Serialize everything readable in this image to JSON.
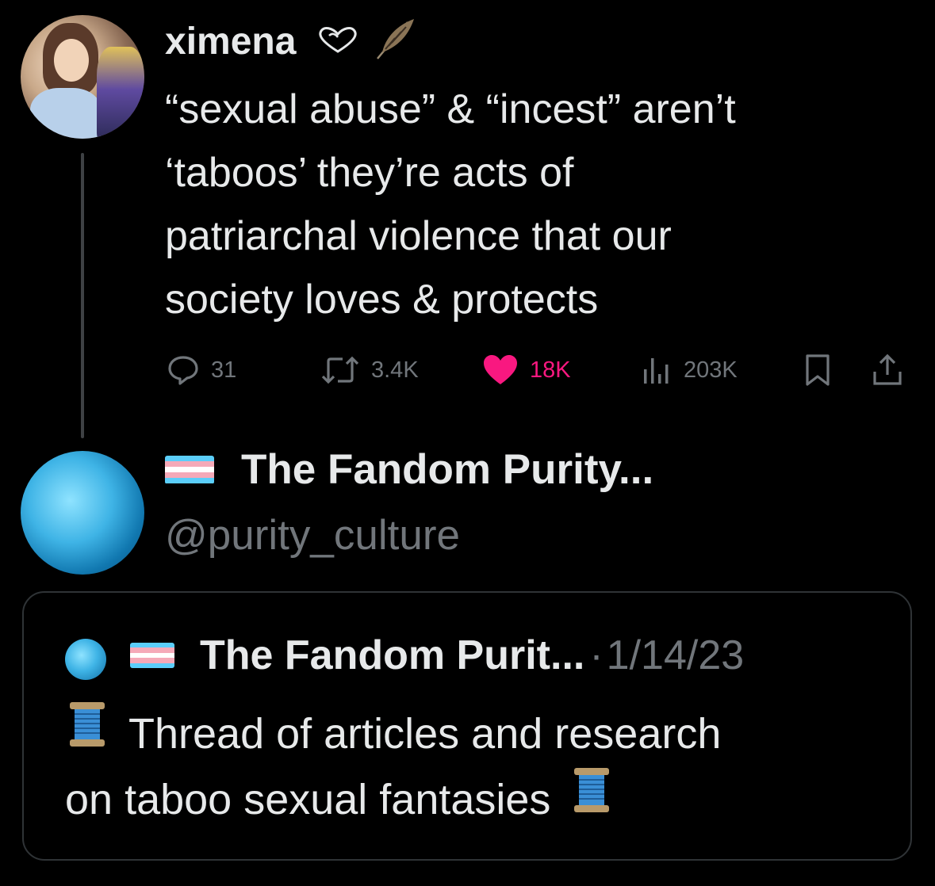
{
  "tweet": {
    "author": {
      "display_name": "ximena",
      "decoration_icons": [
        "heart-outline-icon",
        "feather-icon"
      ]
    },
    "text_lines": [
      "“sexual abuse” & “incest” aren’t",
      "‘taboos’ they’re acts of",
      "patriarchal violence that our",
      "society loves & protects"
    ],
    "actions": {
      "replies": "31",
      "retweets": "3.4K",
      "likes": "18K",
      "views": "203K"
    },
    "colors": {
      "like_active": "#f91880",
      "muted": "#71767b",
      "text": "#e7e9ea"
    }
  },
  "reply_author": {
    "display_name": "The Fandom Purity...",
    "handle": "@purity_culture",
    "flag_icon": "transgender-flag-icon"
  },
  "quoted_tweet": {
    "display_name": "The Fandom Purit...",
    "separator": "·",
    "date": "1/14/23",
    "text_lines": [
      "Thread of articles and research",
      "on taboo sexual fantasies"
    ],
    "emoji_icon": "thread-spool-icon"
  }
}
